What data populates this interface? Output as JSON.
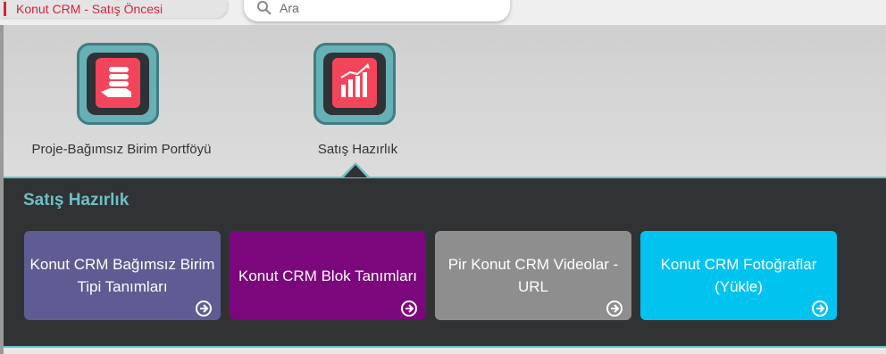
{
  "breadcrumb": {
    "title": "Konut CRM - Satış Öncesi",
    "accent": "#d8233f"
  },
  "search": {
    "placeholder": "Ara",
    "icon": "search-icon"
  },
  "apps": [
    {
      "label": "Proje-Bağımsız Birim Portföyü",
      "icon": "hand-coins-icon"
    },
    {
      "label": "Satış Hazırlık",
      "icon": "chart-growth-icon",
      "selected": true
    }
  ],
  "panel": {
    "title": "Satış Hazırlık",
    "accent": "#6cc0c8",
    "cards": [
      {
        "label": "Konut CRM Bağımsız Birim Tipi Tanımları",
        "color": "#5f5c93",
        "icon": "arrow-right-circle-icon"
      },
      {
        "label": "Konut CRM Blok Tanımları",
        "color": "#7c067c",
        "icon": "arrow-right-circle-icon"
      },
      {
        "label": "Pir Konut CRM Videolar - URL",
        "color": "#8e8e8e",
        "icon": "arrow-right-circle-icon"
      },
      {
        "label": "Konut CRM Fotoğraflar (Yükle)",
        "color": "#00c3ef",
        "icon": "arrow-right-circle-icon"
      }
    ]
  }
}
